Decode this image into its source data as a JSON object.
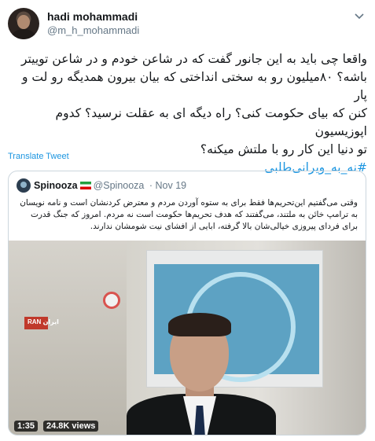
{
  "author": {
    "display_name": "hadi mohammadi",
    "handle": "@m_h_mohammadi"
  },
  "tweet": {
    "lines": [
      "واقعا چی باید به این جانور گفت که در شاعن خودم و در شاعن توییتر",
      "باشه؟ ۸۰میلیون رو به سختی انداختی که بیان بیرون همدیگه رو لت و پار",
      "کنن که بیای حکومت کنی؟ راه دیگه ای به عقلت نرسید؟ کدوم اپوزیسیون",
      "تو دنیا این کار رو با ملتش میکنه؟"
    ],
    "hashtag": "#نه_به_ویرانی‌طلبی",
    "translate_label": "Translate Tweet"
  },
  "quoted": {
    "name": "Spinooza",
    "handle": "@Spinooza",
    "date": "· Nov 19",
    "text": "وقتی می‌گفتیم این‌تحریم‌ها فقط برای به ستوه آوردن مردم و معترض کردنشان است و نامه نویسان به ترامپ خائن به ملتند، می‌گفتند که هدف تحریم‌ها حکومت است نه مردم. امروز که جنگ قدرت برای فردای پیروزی خیالی‌شان بالا گرفته، ابایی از افشای نیت شومشان ندارند.",
    "video": {
      "duration": "1:35",
      "views": "24.8K views",
      "channel_logo": "RAN ایران"
    }
  },
  "icons": {
    "menu": "chevron-down-icon"
  },
  "colors": {
    "link": "#1b95e0",
    "muted": "#657786",
    "border": "#ccd6dd"
  }
}
